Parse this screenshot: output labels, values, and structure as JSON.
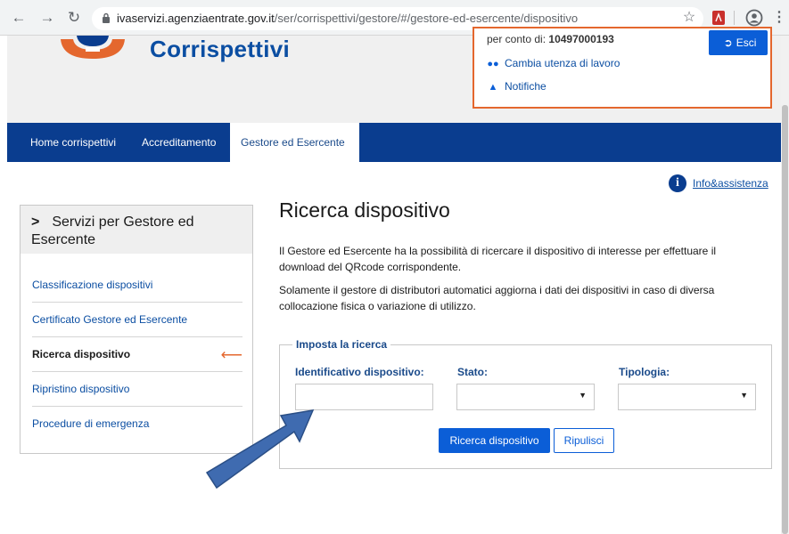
{
  "browser": {
    "url_host": "ivaservizi.agenziaentrate.gov.it",
    "url_path": "/ser/corrispettivi/gestore/#/gestore-ed-esercente/dispositivo"
  },
  "header": {
    "title": "Corrispettivi",
    "owner_label": "per conto di:",
    "owner_value": "10497000193",
    "logout_label": "Esci",
    "change_user_label": "Cambia utenza di lavoro",
    "notifications_label": "Notifiche"
  },
  "nav": {
    "items": [
      "Home corrispettivi",
      "Accreditamento",
      "Gestore ed Esercente"
    ],
    "active": "Gestore ed Esercente"
  },
  "info_link": "Info&assistenza",
  "sidebar": {
    "title": "Servizi per Gestore ed Esercente",
    "items": [
      "Classificazione dispositivi",
      "Certificato Gestore ed Esercente",
      "Ricerca dispositivo",
      "Ripristino dispositivo",
      "Procedure di emergenza"
    ],
    "active": "Ricerca dispositivo"
  },
  "main": {
    "title": "Ricerca dispositivo",
    "paragraph1": "Il Gestore ed Esercente ha la possibilità di ricercare il dispositivo di interesse per effettuare il download del QRcode corrispondente.",
    "paragraph2": "Solamente il gestore di distributori automatici aggiorna i dati dei dispositivi in caso di diversa collocazione fisica o variazione di utilizzo."
  },
  "search": {
    "legend": "Imposta la ricerca",
    "id_label": "Identificativo dispositivo:",
    "id_value": "",
    "stato_label": "Stato:",
    "stato_value": "",
    "tipologia_label": "Tipologia:",
    "tipologia_value": "",
    "search_button": "Ricerca dispositivo",
    "reset_button": "Ripulisci"
  },
  "colors": {
    "brand_blue": "#0a3d8f",
    "button_blue": "#0b5ed7",
    "accent_orange": "#e4672e",
    "callout_arrow": "#3f6bb0"
  }
}
